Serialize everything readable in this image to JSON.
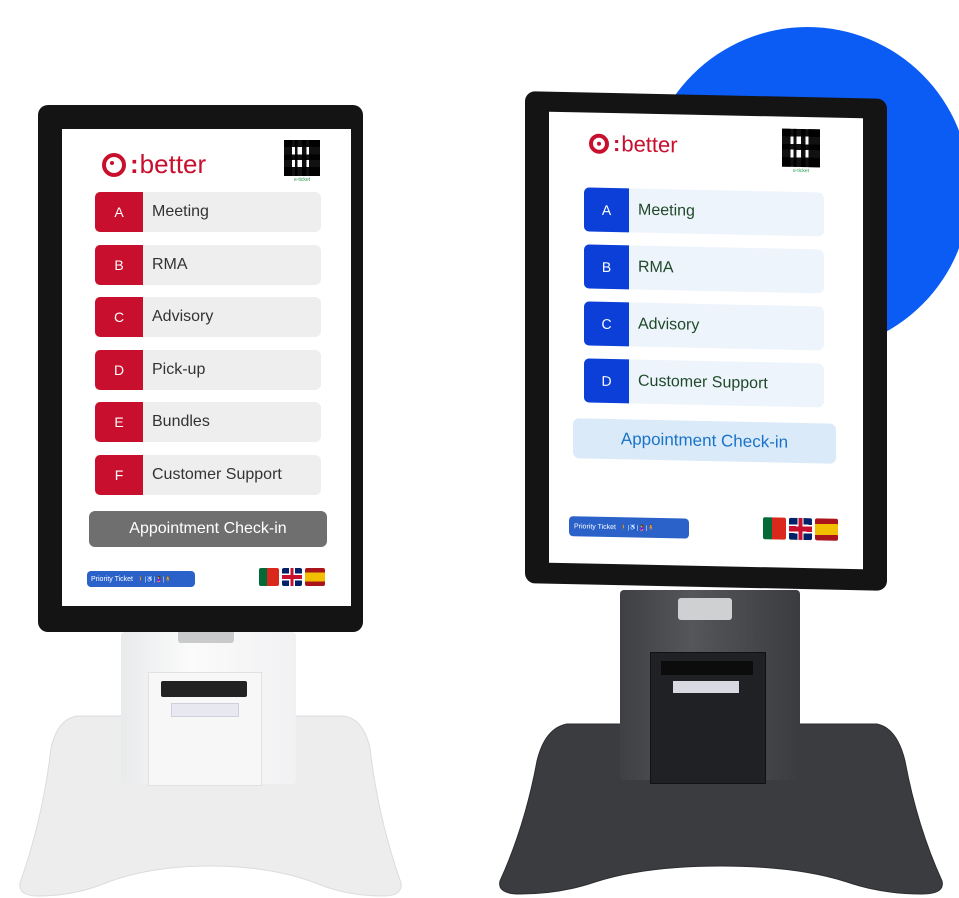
{
  "colors": {
    "accent_blue": "#0a5cf5",
    "kiosk_red": "#c8102e",
    "kiosk_blue": "#0b3fd8",
    "checkin_gray": "#6f6f6f",
    "checkin_light_blue": "#dbeaf8",
    "checkin_text_blue": "#1a73c8"
  },
  "brand": {
    "logo_text": "better"
  },
  "left_kiosk": {
    "qr_caption": "e-ticket",
    "services": [
      {
        "letter": "A",
        "name": "Meeting"
      },
      {
        "letter": "B",
        "name": "RMA"
      },
      {
        "letter": "C",
        "name": "Advisory"
      },
      {
        "letter": "D",
        "name": "Pick-up"
      },
      {
        "letter": "E",
        "name": "Bundles"
      },
      {
        "letter": "F",
        "name": "Customer Support"
      }
    ],
    "checkin_label": "Appointment Check-in",
    "priority_label": "Priority Ticket",
    "priority_icons": "🚶|♿|🤰|🧍",
    "flags": [
      "portugal-flag-icon",
      "uk-flag-icon",
      "spain-flag-icon"
    ]
  },
  "right_kiosk": {
    "qr_caption": "e-ticket",
    "services": [
      {
        "letter": "A",
        "name": "Meeting"
      },
      {
        "letter": "B",
        "name": "RMA"
      },
      {
        "letter": "C",
        "name": "Advisory"
      },
      {
        "letter": "D",
        "name": "Customer Support"
      }
    ],
    "checkin_label": "Appointment Check-in",
    "priority_label": "Priority Ticket",
    "priority_icons": "🚶|♿|🤰|🧍",
    "flags": [
      "portugal-flag-icon",
      "uk-flag-icon",
      "spain-flag-icon"
    ]
  }
}
